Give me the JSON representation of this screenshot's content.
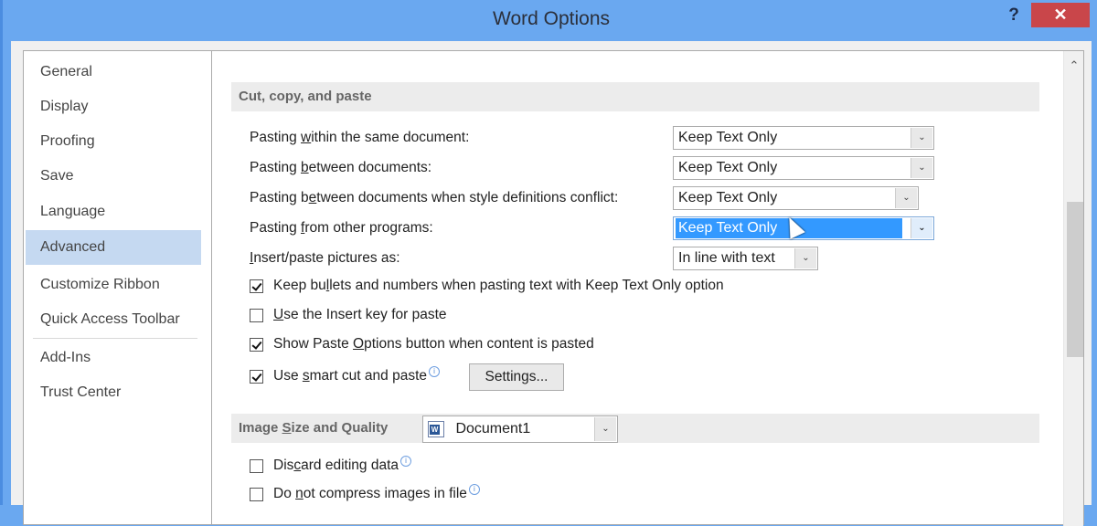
{
  "window": {
    "title": "Word Options",
    "help_label": "?",
    "close_label": "✕"
  },
  "sidebar": {
    "items": [
      {
        "label": "General",
        "selected": false
      },
      {
        "label": "Display",
        "selected": false
      },
      {
        "label": "Proofing",
        "selected": false
      },
      {
        "label": "Save",
        "selected": false
      },
      {
        "label": "Language",
        "selected": false
      },
      {
        "label": "Advanced",
        "selected": true
      },
      {
        "label": "Customize Ribbon",
        "selected": false
      },
      {
        "label": "Quick Access Toolbar",
        "selected": false
      },
      {
        "label": "Add-Ins",
        "selected": false
      },
      {
        "label": "Trust Center",
        "selected": false
      }
    ]
  },
  "cut_copy_paste": {
    "header": "Cut, copy, and paste",
    "options": [
      {
        "label": "Pasting within the same document:",
        "value": "Keep Text Only"
      },
      {
        "label": "Pasting between documents:",
        "value": "Keep Text Only"
      },
      {
        "label": "Pasting between documents when style definitions conflict:",
        "value": "Keep Text Only"
      },
      {
        "label": "Pasting from other programs:",
        "value": "Keep Text Only",
        "focused": true
      },
      {
        "label": "Insert/paste pictures as:",
        "value": "In line with text"
      }
    ],
    "checkboxes": [
      {
        "label": "Keep bullets and numbers when pasting text with Keep Text Only option",
        "checked": true
      },
      {
        "label": "Use the Insert key for paste",
        "checked": false
      },
      {
        "label": "Show Paste Options button when content is pasted",
        "checked": true
      },
      {
        "label": "Use smart cut and paste",
        "checked": true,
        "info": true
      }
    ],
    "settings_button": "Settings..."
  },
  "image_size_quality": {
    "header": "Image Size and Quality",
    "document_select": "Document1",
    "checkboxes": [
      {
        "label": "Discard editing data",
        "checked": false,
        "info": true
      },
      {
        "label": "Do not compress images in file",
        "checked": false,
        "info": true
      }
    ]
  },
  "icons": {
    "chevron_down": "⌄",
    "scroll_up": "⌃",
    "info": "i"
  }
}
